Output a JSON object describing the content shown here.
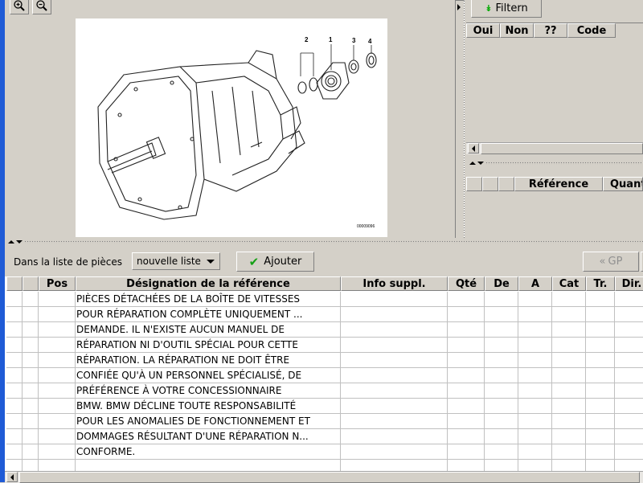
{
  "left_strip_color": "#1f5bd6",
  "toolbar": {
    "zoom_in_icon": "zoom-in-icon",
    "zoom_out_icon": "zoom-out-icon"
  },
  "diagram": {
    "callouts": [
      "2",
      "1",
      "3",
      "4"
    ],
    "image_code": "00009096"
  },
  "filter_panel": {
    "filter_label": "Filtern",
    "columns": [
      "Oui",
      "Non",
      "??",
      "Code"
    ]
  },
  "ref_panel": {
    "columns": [
      "Référence",
      "Quant"
    ]
  },
  "list_bar": {
    "prefix_label": "Dans la liste de pièces",
    "select_value": "nouvelle liste",
    "add_label": "Ajouter",
    "gp_label": "GP"
  },
  "table": {
    "columns": [
      "",
      "",
      "Pos",
      "Désignation de la référence",
      "Info suppl.",
      "Qté",
      "De",
      "A",
      "Cat",
      "Tr.",
      "Dir."
    ],
    "rows": [
      "PIÈCES DÉTACHÉES DE LA BOÎTE DE VITESSES",
      "POUR RÉPARATION COMPLÈTE UNIQUEMENT ...",
      "DEMANDE. IL N'EXISTE AUCUN MANUEL DE",
      "RÉPARATION NI D'OUTIL SPÉCIAL POUR CETTE",
      "RÉPARATION. LA RÉPARATION NE DOIT ÊTRE",
      "CONFIÉE QU'À UN PERSONNEL SPÉCIALISÉ, DE",
      "PRÉFÉRENCE À VOTRE CONCESSIONNAIRE",
      "BMW. BMW DÉCLINE TOUTE RESPONSABILITÉ",
      "POUR LES ANOMALIES DE FONCTIONNEMENT ET",
      "DOMMAGES RÉSULTANT D'UNE RÉPARATION N...",
      "CONFORME.",
      ""
    ]
  }
}
